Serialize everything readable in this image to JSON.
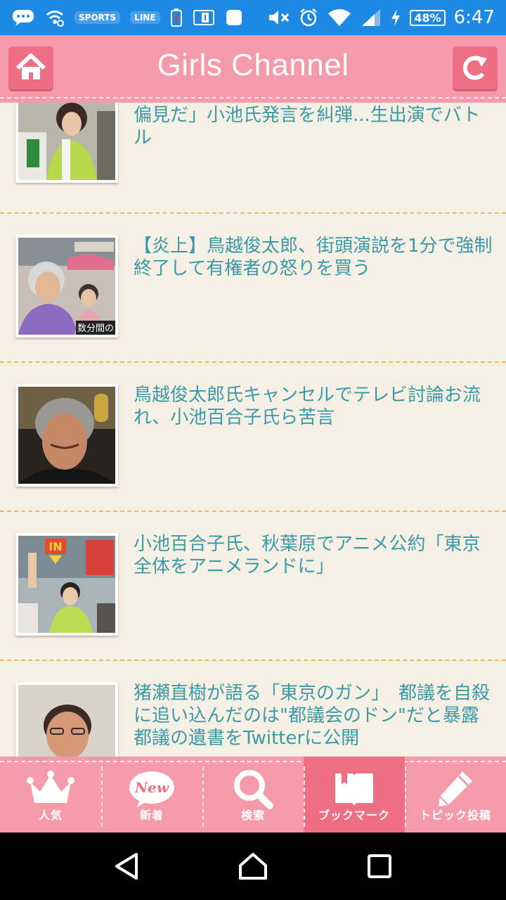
{
  "status_bar": {
    "app_icons": [
      "chat-bubble-icon",
      "wifi-settings-icon",
      "sports-app-icon",
      "line-app-icon",
      "battery-alert-icon",
      "info-screen-icon",
      "white-square-icon"
    ],
    "sports_label": "SPORTS",
    "line_label": "LINE",
    "battery_percent": "48%",
    "time": "6:47"
  },
  "header": {
    "title": "Girls Channel",
    "home_icon": "home-icon",
    "refresh_icon": "refresh-icon",
    "colors": {
      "header_bg": "#f49aa8",
      "button_bg": "#ee6f83"
    }
  },
  "articles": [
    {
      "title": "【都知事選】鳥越氏「がんサバイバーへの偏見だ」小池氏発言を糾弾...生出演でバトル"
    },
    {
      "title": "【炎上】鳥越俊太郎、街頭演説を1分で強制終了して有権者の怒りを買う",
      "thumb_caption": "数分間の"
    },
    {
      "title": "鳥越俊太郎氏キャンセルでテレビ討論お流れ、小池百合子氏ら苦言"
    },
    {
      "title": "小池百合子氏、秋葉原でアニメ公約「東京全体をアニメランドに」",
      "thumb_sign": "IN"
    },
    {
      "title": "猪瀬直樹が語る「東京のガン」　都議を自殺に追い込んだのは\"都議会のドン\"だと暴露　都議の遺書をTwitterに公開"
    }
  ],
  "bottom_nav": [
    {
      "label": "人気",
      "icon": "crown-icon"
    },
    {
      "label": "新着",
      "icon": "new-badge-icon",
      "badge": "New"
    },
    {
      "label": "検索",
      "icon": "search-icon"
    },
    {
      "label": "ブックマーク",
      "icon": "bookmark-book-icon",
      "active": true
    },
    {
      "label": "トピック投稿",
      "icon": "pencil-icon"
    }
  ],
  "colors": {
    "text_link": "#3a9aa8",
    "background": "#f6efe3",
    "divider": "#f2b36a"
  }
}
